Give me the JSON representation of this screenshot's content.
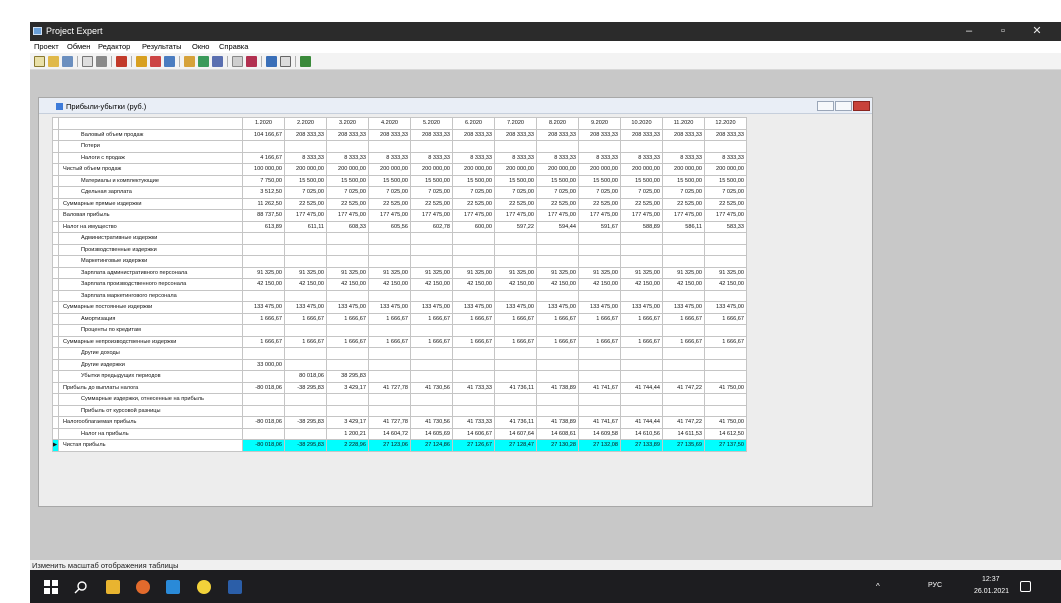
{
  "window": {
    "title": "Project Expert"
  },
  "menu": [
    "Проект",
    "Обмен",
    "Редактор",
    "Результаты",
    "Окно",
    "Справка"
  ],
  "icons": {
    "toolbar": [
      "new-doc-icon",
      "open-folder-icon",
      "save-icon",
      "print-preview-icon",
      "print-icon",
      "calculate-icon",
      "table-icon",
      "chart-icon",
      "analysis-icon",
      "report-icon",
      "data-icon",
      "chart-line-icon",
      "sensitivity-icon",
      "export-icon",
      "window-icon",
      "window2-icon",
      "help-icon"
    ],
    "taskbar": [
      "windows-start-icon",
      "search-icon",
      "file-explorer-icon",
      "firefox-icon",
      "vscode-icon",
      "bulb-icon",
      "word-icon"
    ]
  },
  "child_window": {
    "title": "Прибыли-убытки (руб.)"
  },
  "table": {
    "columns": [
      "1.2020",
      "2.2020",
      "3.2020",
      "4.2020",
      "5.2020",
      "6.2020",
      "7.2020",
      "8.2020",
      "9.2020",
      "10.2020",
      "11.2020",
      "12.2020"
    ],
    "rows": [
      {
        "label": "Валовый объем продаж",
        "indent": true,
        "values": [
          "104 166,67",
          "208 333,33",
          "208 333,33",
          "208 333,33",
          "208 333,33",
          "208 333,33",
          "208 333,33",
          "208 333,33",
          "208 333,33",
          "208 333,33",
          "208 333,33",
          "208 333,33"
        ]
      },
      {
        "label": "Потери",
        "indent": true,
        "values": [
          "",
          "",
          "",
          "",
          "",
          "",
          "",
          "",
          "",
          "",
          "",
          ""
        ]
      },
      {
        "label": "Налоги с продаж",
        "indent": true,
        "values": [
          "4 166,67",
          "8 333,33",
          "8 333,33",
          "8 333,33",
          "8 333,33",
          "8 333,33",
          "8 333,33",
          "8 333,33",
          "8 333,33",
          "8 333,33",
          "8 333,33",
          "8 333,33"
        ]
      },
      {
        "label": "Чистый объем продаж",
        "indent": false,
        "values": [
          "100 000,00",
          "200 000,00",
          "200 000,00",
          "200 000,00",
          "200 000,00",
          "200 000,00",
          "200 000,00",
          "200 000,00",
          "200 000,00",
          "200 000,00",
          "200 000,00",
          "200 000,00"
        ]
      },
      {
        "label": "Материалы и комплектующие",
        "indent": true,
        "values": [
          "7 750,00",
          "15 500,00",
          "15 500,00",
          "15 500,00",
          "15 500,00",
          "15 500,00",
          "15 500,00",
          "15 500,00",
          "15 500,00",
          "15 500,00",
          "15 500,00",
          "15 500,00"
        ]
      },
      {
        "label": "Сдельная зарплата",
        "indent": true,
        "values": [
          "3 512,50",
          "7 025,00",
          "7 025,00",
          "7 025,00",
          "7 025,00",
          "7 025,00",
          "7 025,00",
          "7 025,00",
          "7 025,00",
          "7 025,00",
          "7 025,00",
          "7 025,00"
        ]
      },
      {
        "label": "Суммарные прямые издержки",
        "indent": false,
        "values": [
          "11 262,50",
          "22 525,00",
          "22 525,00",
          "22 525,00",
          "22 525,00",
          "22 525,00",
          "22 525,00",
          "22 525,00",
          "22 525,00",
          "22 525,00",
          "22 525,00",
          "22 525,00"
        ]
      },
      {
        "label": "Валовая прибыль",
        "indent": false,
        "values": [
          "88 737,50",
          "177 475,00",
          "177 475,00",
          "177 475,00",
          "177 475,00",
          "177 475,00",
          "177 475,00",
          "177 475,00",
          "177 475,00",
          "177 475,00",
          "177 475,00",
          "177 475,00"
        ]
      },
      {
        "label": "Налог на имущество",
        "indent": false,
        "values": [
          "613,89",
          "611,11",
          "608,33",
          "605,56",
          "602,78",
          "600,00",
          "597,22",
          "594,44",
          "591,67",
          "588,89",
          "586,11",
          "583,33"
        ]
      },
      {
        "label": "Административные издержки",
        "indent": true,
        "values": [
          "",
          "",
          "",
          "",
          "",
          "",
          "",
          "",
          "",
          "",
          "",
          ""
        ]
      },
      {
        "label": "Производственные издержки",
        "indent": true,
        "values": [
          "",
          "",
          "",
          "",
          "",
          "",
          "",
          "",
          "",
          "",
          "",
          ""
        ]
      },
      {
        "label": "Маркетинговые издержки",
        "indent": true,
        "values": [
          "",
          "",
          "",
          "",
          "",
          "",
          "",
          "",
          "",
          "",
          "",
          ""
        ]
      },
      {
        "label": "Зарплата административного персонала",
        "indent": true,
        "values": [
          "91 325,00",
          "91 325,00",
          "91 325,00",
          "91 325,00",
          "91 325,00",
          "91 325,00",
          "91 325,00",
          "91 325,00",
          "91 325,00",
          "91 325,00",
          "91 325,00",
          "91 325,00"
        ]
      },
      {
        "label": "Зарплата производственного персонала",
        "indent": true,
        "values": [
          "42 150,00",
          "42 150,00",
          "42 150,00",
          "42 150,00",
          "42 150,00",
          "42 150,00",
          "42 150,00",
          "42 150,00",
          "42 150,00",
          "42 150,00",
          "42 150,00",
          "42 150,00"
        ]
      },
      {
        "label": "Зарплата маркетингового персонала",
        "indent": true,
        "values": [
          "",
          "",
          "",
          "",
          "",
          "",
          "",
          "",
          "",
          "",
          "",
          ""
        ]
      },
      {
        "label": "Суммарные постоянные издержки",
        "indent": false,
        "values": [
          "133 475,00",
          "133 475,00",
          "133 475,00",
          "133 475,00",
          "133 475,00",
          "133 475,00",
          "133 475,00",
          "133 475,00",
          "133 475,00",
          "133 475,00",
          "133 475,00",
          "133 475,00"
        ]
      },
      {
        "label": "Амортизация",
        "indent": true,
        "values": [
          "1 666,67",
          "1 666,67",
          "1 666,67",
          "1 666,67",
          "1 666,67",
          "1 666,67",
          "1 666,67",
          "1 666,67",
          "1 666,67",
          "1 666,67",
          "1 666,67",
          "1 666,67"
        ]
      },
      {
        "label": "Проценты по кредитам",
        "indent": true,
        "values": [
          "",
          "",
          "",
          "",
          "",
          "",
          "",
          "",
          "",
          "",
          "",
          ""
        ]
      },
      {
        "label": "Суммарные непроизводственные издержки",
        "indent": false,
        "values": [
          "1 666,67",
          "1 666,67",
          "1 666,67",
          "1 666,67",
          "1 666,67",
          "1 666,67",
          "1 666,67",
          "1 666,67",
          "1 666,67",
          "1 666,67",
          "1 666,67",
          "1 666,67"
        ]
      },
      {
        "label": "Другие доходы",
        "indent": true,
        "values": [
          "",
          "",
          "",
          "",
          "",
          "",
          "",
          "",
          "",
          "",
          "",
          ""
        ]
      },
      {
        "label": "Другие издержки",
        "indent": true,
        "values": [
          "33 000,00",
          "",
          "",
          "",
          "",
          "",
          "",
          "",
          "",
          "",
          "",
          ""
        ]
      },
      {
        "label": "Убытки предыдущих периодов",
        "indent": true,
        "values": [
          "",
          "80 018,06",
          "38 295,83",
          "",
          "",
          "",
          "",
          "",
          "",
          "",
          "",
          ""
        ]
      },
      {
        "label": "Прибыль до выплаты налога",
        "indent": false,
        "values": [
          "-80 018,06",
          "-38 295,83",
          "3 429,17",
          "41 727,78",
          "41 730,56",
          "41 733,33",
          "41 736,11",
          "41 738,89",
          "41 741,67",
          "41 744,44",
          "41 747,22",
          "41 750,00"
        ]
      },
      {
        "label": "Суммарные издержки, отнесенные на прибыль",
        "indent": true,
        "values": [
          "",
          "",
          "",
          "",
          "",
          "",
          "",
          "",
          "",
          "",
          "",
          ""
        ]
      },
      {
        "label": "Прибыль от курсовой разницы",
        "indent": true,
        "values": [
          "",
          "",
          "",
          "",
          "",
          "",
          "",
          "",
          "",
          "",
          "",
          ""
        ]
      },
      {
        "label": "Налогооблагаемая прибыль",
        "indent": false,
        "values": [
          "-80 018,06",
          "-38 295,83",
          "3 429,17",
          "41 727,78",
          "41 730,56",
          "41 733,33",
          "41 736,11",
          "41 738,89",
          "41 741,67",
          "41 744,44",
          "41 747,22",
          "41 750,00"
        ]
      },
      {
        "label": "Налог на прибыль",
        "indent": true,
        "values": [
          "",
          "",
          "1 200,21",
          "14 604,72",
          "14 605,69",
          "14 606,67",
          "14 607,64",
          "14 608,61",
          "14 609,58",
          "14 610,56",
          "14 611,53",
          "14 612,50"
        ]
      },
      {
        "label": "Чистая прибыль",
        "indent": false,
        "selected": true,
        "values": [
          "-80 018,06",
          "-38 295,83",
          "2 228,96",
          "27 123,06",
          "27 124,86",
          "27 126,67",
          "27 128,47",
          "27 130,28",
          "27 132,08",
          "27 133,89",
          "27 135,69",
          "27 137,50"
        ]
      }
    ]
  },
  "status": {
    "text": "Изменить масштаб отображения таблицы"
  },
  "tray": {
    "lang": "РУС",
    "time": "12:37",
    "date": "26.01.2021"
  }
}
